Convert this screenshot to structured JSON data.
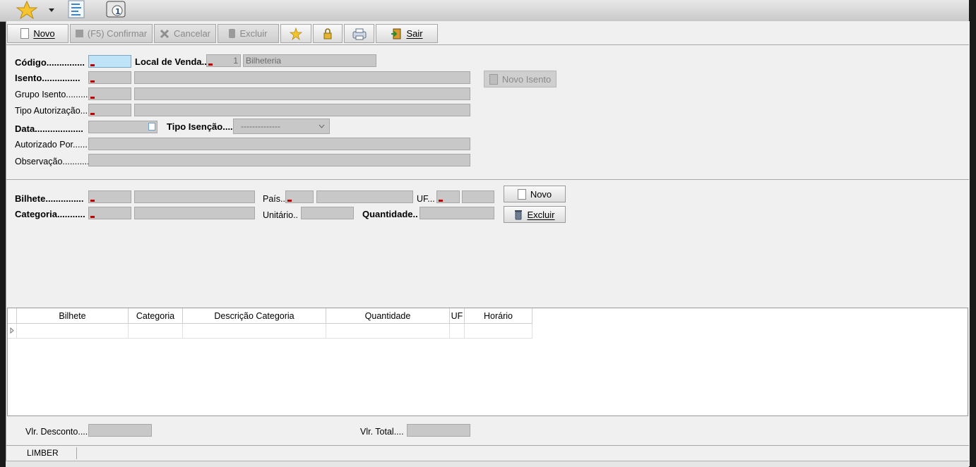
{
  "toolbar": {
    "novo": "Novo",
    "confirmar": "(F5) Confirmar",
    "cancelar": "Cancelar",
    "excluir": "Excluir",
    "sair": "Sair"
  },
  "form": {
    "codigo_label": "Código...............",
    "local_venda_label": "Local de Venda..",
    "local_venda_code": "1",
    "local_venda_name": "Bilheteria",
    "isento_label": "Isento...............",
    "grupo_isento_label": "Grupo Isento.........",
    "tipo_autorizacao_label": "Tipo Autorização....",
    "data_label": "Data...................",
    "tipo_isencao_label": "Tipo Isenção....",
    "tipo_isencao_value": "--------------",
    "autorizado_por_label": "Autorizado Por.......",
    "observacao_label": "Observação...........",
    "novo_isento_button": "Novo Isento"
  },
  "item": {
    "bilhete_label": "Bilhete...............",
    "categoria_label": "Categoria...........",
    "pais_label": "País..",
    "uf_label": "UF...",
    "unitario_label": "Unitário..",
    "quantidade_label": "Quantidade..",
    "novo_button": "Novo",
    "excluir_button": "Excluir"
  },
  "grid": {
    "columns": [
      "Bilhete",
      "Categoria",
      "Descrição Categoria",
      "Quantidade",
      "UF",
      "Horário"
    ]
  },
  "totals": {
    "desconto_label": "Vlr. Desconto....",
    "total_label": "Vlr. Total...."
  },
  "status": {
    "user": "LIMBER"
  }
}
